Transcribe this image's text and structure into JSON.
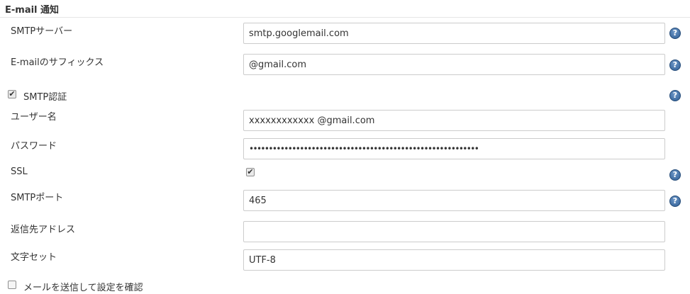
{
  "section": {
    "title": "E-mail 通知"
  },
  "help_glyph": "?",
  "check_glyph": "✔",
  "smtp_server": {
    "label": "SMTPサーバー",
    "value": "smtp.googlemail.com"
  },
  "email_suffix": {
    "label": "E-mailのサフィックス",
    "value": "@gmail.com"
  },
  "smtp_auth": {
    "label": "SMTP認証",
    "checked": true
  },
  "username": {
    "label": "ユーザー名",
    "value": "xxxxxxxxxxxx @gmail.com"
  },
  "password": {
    "label": "パスワード",
    "value": "•••••••••••••••••••••••••••••••••••••••••••••••••••••••••••"
  },
  "ssl": {
    "label": "SSL",
    "checked": true
  },
  "smtp_port": {
    "label": "SMTPポート",
    "value": "465"
  },
  "reply_to": {
    "label": "返信先アドレス",
    "value": ""
  },
  "charset": {
    "label": "文字セット",
    "value": "UTF-8"
  },
  "test_mail": {
    "label": "メールを送信して設定を確認",
    "checked": false
  },
  "colors": {
    "help_icon": "#2d5c93",
    "border": "#cccccc"
  }
}
